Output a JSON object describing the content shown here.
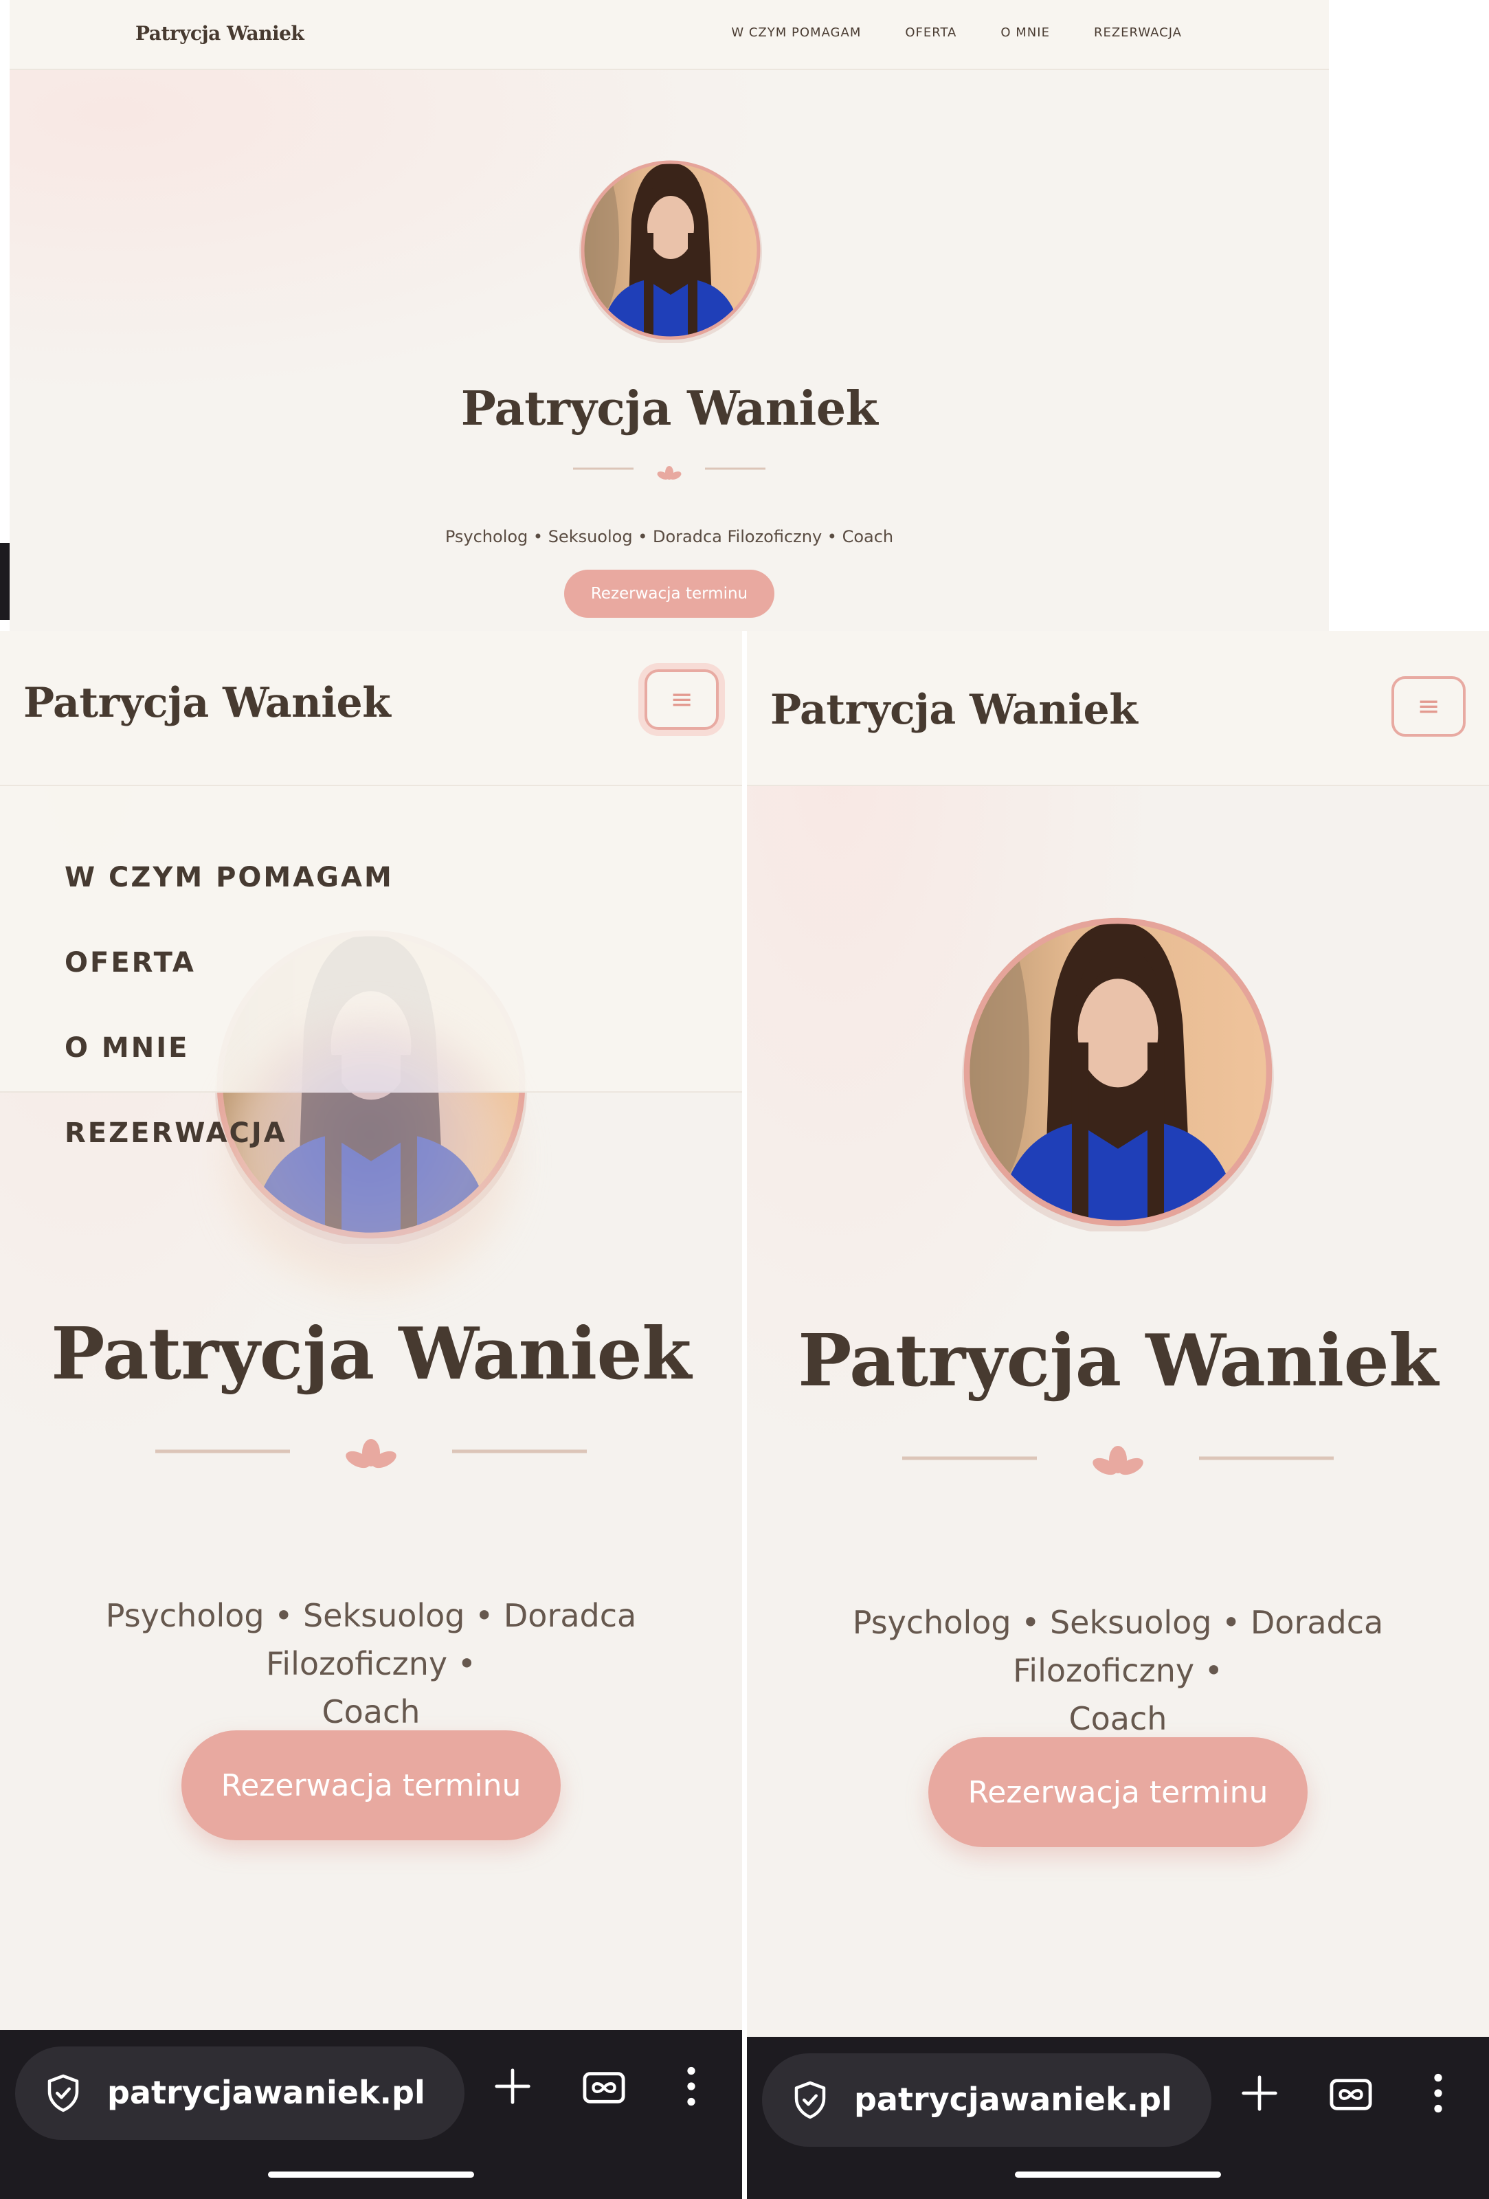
{
  "site": {
    "brand": "Patrycja Waniek",
    "nav": [
      "W CZYM POMAGAM",
      "OFERTA",
      "O MNIE",
      "REZERWACJA"
    ],
    "hero": {
      "title": "Patrycja Waniek",
      "tagline_line1": "Psycholog • Seksuolog • Doradca Filozoficzny •",
      "tagline_line2": "Coach",
      "tagline_full": "Psycholog • Seksuolog • Doradca Filozoficzny • Coach",
      "cta": "Rezerwacja terminu",
      "menu_glyph": "≡"
    }
  },
  "browser": {
    "url": "patrycjawaniek.pl",
    "icons": [
      "shield-check-icon",
      "plus-icon",
      "tab-switcher-icon",
      "more-vertical-icon"
    ]
  },
  "colors": {
    "accent": "#e8a9a0",
    "text_dark": "#473a30",
    "background": "#f5f2ee",
    "chrome": "#1d1b20"
  }
}
